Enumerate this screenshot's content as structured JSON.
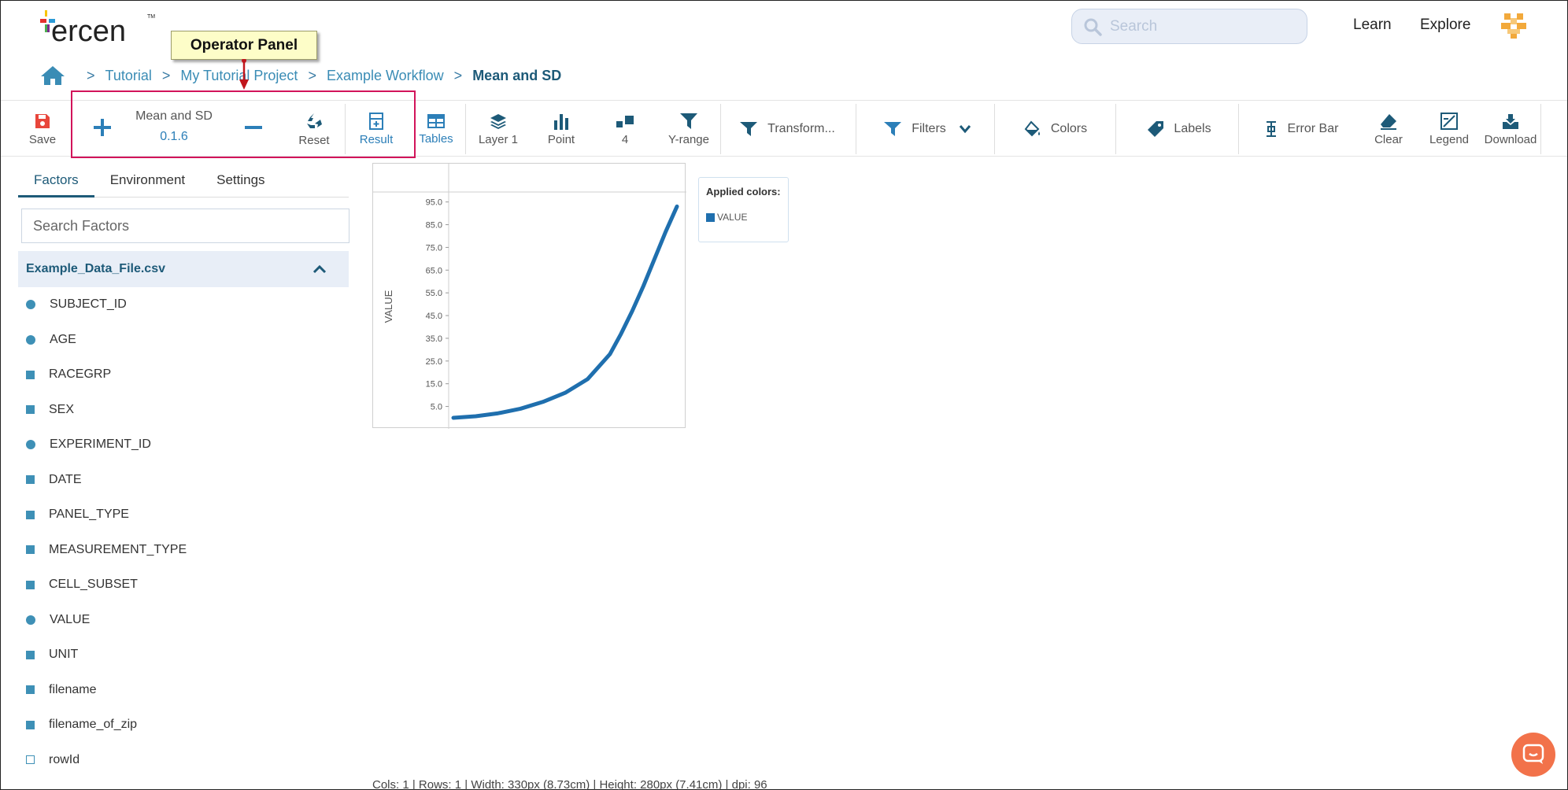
{
  "app": {
    "logo_text": "ercen",
    "logo_tm": "TM"
  },
  "header": {
    "search_placeholder": "Search",
    "nav": {
      "learn": "Learn",
      "explore": "Explore"
    }
  },
  "breadcrumb": {
    "separator": ">",
    "items": [
      "Tutorial",
      "My Tutorial Project",
      "Example Workflow",
      "Mean and SD"
    ]
  },
  "callout": {
    "label": "Operator Panel"
  },
  "toolbar": {
    "save": "Save",
    "operator": {
      "name": "Mean and SD",
      "version": "0.1.6"
    },
    "reset": "Reset",
    "result": "Result",
    "tables": "Tables",
    "layer": "Layer 1",
    "point": "Point",
    "count": "4",
    "yrange": "Y-range",
    "transform": "Transform...",
    "filters": "Filters",
    "colors": "Colors",
    "labels": "Labels",
    "error_bar": "Error Bar",
    "clear": "Clear",
    "legend": "Legend",
    "download": "Download"
  },
  "left_panel": {
    "tabs": [
      "Factors",
      "Environment",
      "Settings"
    ],
    "active_tab": "Factors",
    "search_placeholder": "Search Factors",
    "dataset": "Example_Data_File.csv",
    "factors": [
      {
        "name": "SUBJECT_ID",
        "kind": "circle"
      },
      {
        "name": "AGE",
        "kind": "circle"
      },
      {
        "name": "RACEGRP",
        "kind": "square"
      },
      {
        "name": "SEX",
        "kind": "square"
      },
      {
        "name": "EXPERIMENT_ID",
        "kind": "circle"
      },
      {
        "name": "DATE",
        "kind": "square"
      },
      {
        "name": "PANEL_TYPE",
        "kind": "square"
      },
      {
        "name": "MEASUREMENT_TYPE",
        "kind": "square"
      },
      {
        "name": "CELL_SUBSET",
        "kind": "square"
      },
      {
        "name": "VALUE",
        "kind": "circle"
      },
      {
        "name": "UNIT",
        "kind": "square"
      },
      {
        "name": "filename",
        "kind": "square"
      },
      {
        "name": "filename_of_zip",
        "kind": "square"
      },
      {
        "name": "rowId",
        "kind": "empty"
      }
    ]
  },
  "chart_data": {
    "type": "line",
    "ylabel": "VALUE",
    "xlabel": "",
    "title": "",
    "y_ticks": [
      5.0,
      15.0,
      25.0,
      35.0,
      45.0,
      55.0,
      65.0,
      75.0,
      85.0,
      95.0
    ],
    "y_tick_labels": [
      "5.0",
      "15.0",
      "25.0",
      "35.0",
      "45.0",
      "55.0",
      "65.0",
      "75.0",
      "85.0",
      "95.0"
    ],
    "ylim": [
      0,
      98
    ],
    "xlim": [
      0,
      100
    ],
    "grid": false,
    "series": [
      {
        "color": "#1f6fae",
        "x": [
          0,
          10,
          20,
          30,
          40,
          50,
          60,
          70,
          75,
          80,
          85,
          90,
          95,
          100
        ],
        "y": [
          0,
          0.7,
          2,
          4,
          7,
          11,
          17,
          28,
          37,
          47,
          58,
          70,
          82,
          93
        ]
      }
    ]
  },
  "legend": {
    "title": "Applied colors:",
    "entries": [
      {
        "label": "VALUE",
        "color": "#1f6fae"
      }
    ]
  },
  "footer": {
    "status": "Cols: 1 | Rows: 1 | Width: 330px (8.73cm) | Height: 280px (7.41cm) | dpi: 96"
  },
  "colors": {
    "accent": "#2c7fb8",
    "dark_accent": "#1d5a78",
    "highlight": "#d2145a",
    "save_red": "#e8463b"
  }
}
